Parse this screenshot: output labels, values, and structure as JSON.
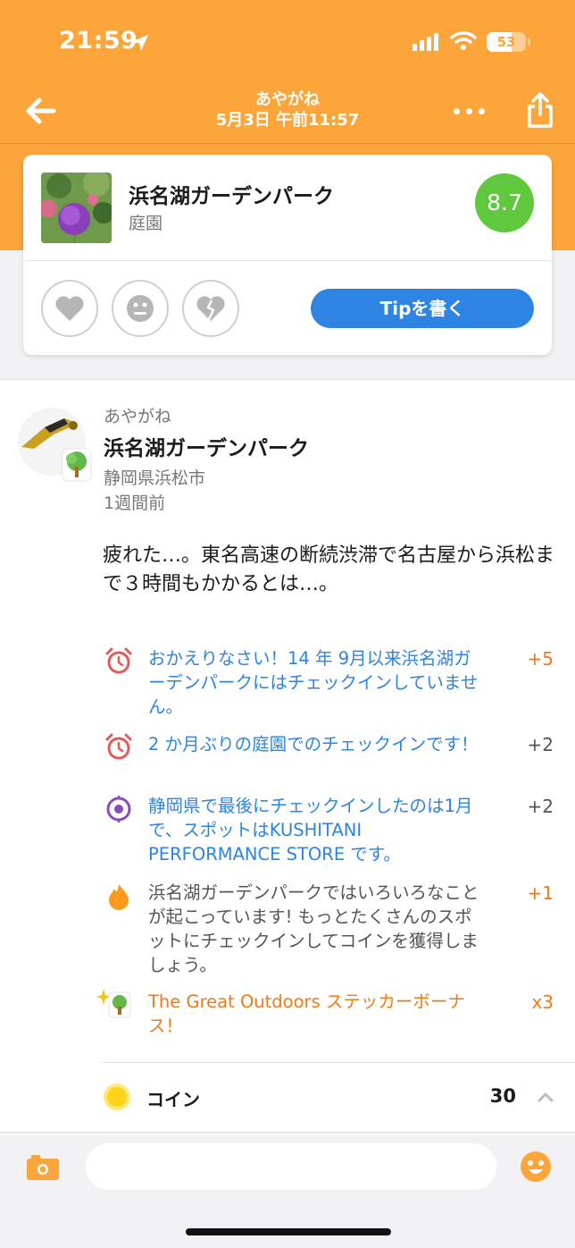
{
  "status_bar": {
    "time": "21:59",
    "battery": "53"
  },
  "nav": {
    "user": "あやがね",
    "datetime": "5月3日 午前11:57"
  },
  "venue": {
    "name": "浜名湖ガーデンパーク",
    "category": "庭園",
    "score": "8.7",
    "tip_button": "Tipを書く"
  },
  "post": {
    "user": "あやがね",
    "venue": "浜名湖ガーデンパーク",
    "location": "静岡県浜松市",
    "time": "1週間前",
    "body": "疲れた…。東名高速の断続渋滞で名古屋から浜松まで３時間もかかるとは…。"
  },
  "bonuses": [
    {
      "icon": "alarm-clock-icon",
      "text": "おかえりなさい！14 年 9月以来浜名湖ガーデンパークにはチェックインしていません。",
      "points": "+5"
    },
    {
      "icon": "alarm-clock-icon",
      "text": "2 か月ぶりの庭園でのチェックインです！",
      "points": "+2"
    },
    {
      "icon": "location-pin-icon",
      "text": "静岡県で最後にチェックインしたのは1月で、スポットはKUSHITANI PERFORMANCE STORE です。",
      "points": "+2"
    },
    {
      "icon": "flame-icon",
      "text": "浜名湖ガーデンパークではいろいろなことが起こっています! もっとたくさんのスポットにチェックインしてコインを獲得しましょう。",
      "points": "+1"
    },
    {
      "icon": "tree-sticker-icon",
      "text": "The Great Outdoors ステッカーボーナス！",
      "points": "x3"
    }
  ],
  "coins": {
    "label": "コイン",
    "total": "30"
  },
  "comment": {
    "placeholder": ""
  },
  "colors": {
    "brand_orange": "#fba53a",
    "score_green": "#5fc83d",
    "link_blue": "#2d84e3",
    "points_orange": "#f07a14"
  }
}
